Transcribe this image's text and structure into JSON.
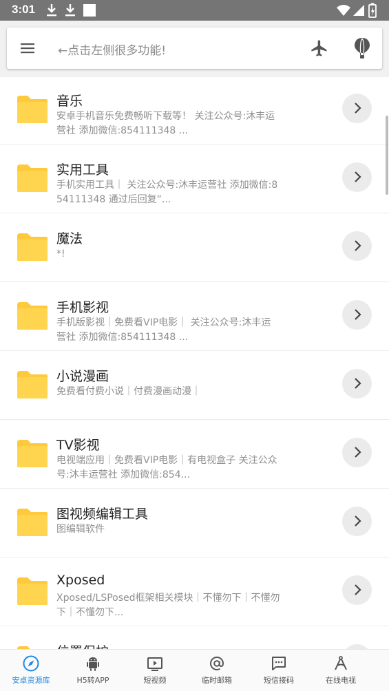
{
  "status_bar": {
    "time": "3:01"
  },
  "search": {
    "hint": "←点击左侧很多功能!"
  },
  "items": [
    {
      "title": "音乐",
      "desc": "安卓手机音乐免费畅听下载等！ 关注公众号:沐丰运营社 添加微信:854111348 ..."
    },
    {
      "title": "实用工具",
      "desc": "手机实用工具｜ 关注公众号:沐丰运营社 添加微信:854111348 通过后回复“..."
    },
    {
      "title": "魔法",
      "desc": "*!"
    },
    {
      "title": "手机影视",
      "desc": "手机版影视｜免费看VIP电影｜ 关注公众号:沐丰运营社 添加微信:854111348 ..."
    },
    {
      "title": "小说漫画",
      "desc": "免费看付费小说｜付费漫画动漫｜"
    },
    {
      "title": "TV影视",
      "desc": "电视端应用｜免费看VIP电影｜有电视盒子 关注公众号:沐丰运营社 添加微信:854..."
    },
    {
      "title": "图视频编辑工具",
      "desc": "图编辑软件"
    },
    {
      "title": "Xposed",
      "desc": "Xposed/LSPosed框架相关模块｜不懂勿下｜不懂勿下｜不懂勿下..."
    },
    {
      "title": "位置保护",
      "desc": ""
    }
  ],
  "nav": {
    "items": [
      {
        "label": "安卓资源库",
        "icon": "compass-icon",
        "active": true
      },
      {
        "label": "H5转APP",
        "icon": "android-icon",
        "active": false
      },
      {
        "label": "短视频",
        "icon": "video-icon",
        "active": false
      },
      {
        "label": "临时邮箱",
        "icon": "at-icon",
        "active": false
      },
      {
        "label": "短信接码",
        "icon": "sms-icon",
        "active": false
      },
      {
        "label": "在线电视",
        "icon": "tv-antenna-icon",
        "active": false
      }
    ]
  },
  "colors": {
    "folder": "#FFD54F",
    "folder_tab": "#FFC93C",
    "accent": "#1E88E5",
    "status_bar": "#757575"
  }
}
